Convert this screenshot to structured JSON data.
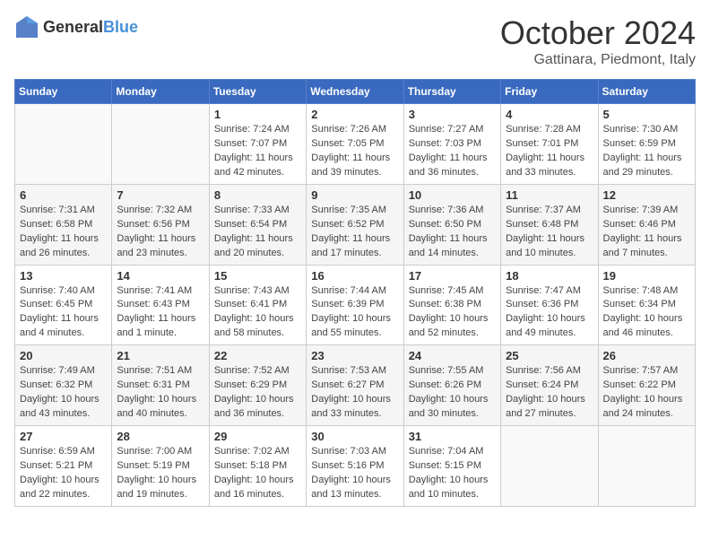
{
  "logo": {
    "general": "General",
    "blue": "Blue"
  },
  "header": {
    "month": "October 2024",
    "location": "Gattinara, Piedmont, Italy"
  },
  "weekdays": [
    "Sunday",
    "Monday",
    "Tuesday",
    "Wednesday",
    "Thursday",
    "Friday",
    "Saturday"
  ],
  "weeks": [
    [
      {
        "day": "",
        "sunrise": "",
        "sunset": "",
        "daylight": ""
      },
      {
        "day": "",
        "sunrise": "",
        "sunset": "",
        "daylight": ""
      },
      {
        "day": "1",
        "sunrise": "Sunrise: 7:24 AM",
        "sunset": "Sunset: 7:07 PM",
        "daylight": "Daylight: 11 hours and 42 minutes."
      },
      {
        "day": "2",
        "sunrise": "Sunrise: 7:26 AM",
        "sunset": "Sunset: 7:05 PM",
        "daylight": "Daylight: 11 hours and 39 minutes."
      },
      {
        "day": "3",
        "sunrise": "Sunrise: 7:27 AM",
        "sunset": "Sunset: 7:03 PM",
        "daylight": "Daylight: 11 hours and 36 minutes."
      },
      {
        "day": "4",
        "sunrise": "Sunrise: 7:28 AM",
        "sunset": "Sunset: 7:01 PM",
        "daylight": "Daylight: 11 hours and 33 minutes."
      },
      {
        "day": "5",
        "sunrise": "Sunrise: 7:30 AM",
        "sunset": "Sunset: 6:59 PM",
        "daylight": "Daylight: 11 hours and 29 minutes."
      }
    ],
    [
      {
        "day": "6",
        "sunrise": "Sunrise: 7:31 AM",
        "sunset": "Sunset: 6:58 PM",
        "daylight": "Daylight: 11 hours and 26 minutes."
      },
      {
        "day": "7",
        "sunrise": "Sunrise: 7:32 AM",
        "sunset": "Sunset: 6:56 PM",
        "daylight": "Daylight: 11 hours and 23 minutes."
      },
      {
        "day": "8",
        "sunrise": "Sunrise: 7:33 AM",
        "sunset": "Sunset: 6:54 PM",
        "daylight": "Daylight: 11 hours and 20 minutes."
      },
      {
        "day": "9",
        "sunrise": "Sunrise: 7:35 AM",
        "sunset": "Sunset: 6:52 PM",
        "daylight": "Daylight: 11 hours and 17 minutes."
      },
      {
        "day": "10",
        "sunrise": "Sunrise: 7:36 AM",
        "sunset": "Sunset: 6:50 PM",
        "daylight": "Daylight: 11 hours and 14 minutes."
      },
      {
        "day": "11",
        "sunrise": "Sunrise: 7:37 AM",
        "sunset": "Sunset: 6:48 PM",
        "daylight": "Daylight: 11 hours and 10 minutes."
      },
      {
        "day": "12",
        "sunrise": "Sunrise: 7:39 AM",
        "sunset": "Sunset: 6:46 PM",
        "daylight": "Daylight: 11 hours and 7 minutes."
      }
    ],
    [
      {
        "day": "13",
        "sunrise": "Sunrise: 7:40 AM",
        "sunset": "Sunset: 6:45 PM",
        "daylight": "Daylight: 11 hours and 4 minutes."
      },
      {
        "day": "14",
        "sunrise": "Sunrise: 7:41 AM",
        "sunset": "Sunset: 6:43 PM",
        "daylight": "Daylight: 11 hours and 1 minute."
      },
      {
        "day": "15",
        "sunrise": "Sunrise: 7:43 AM",
        "sunset": "Sunset: 6:41 PM",
        "daylight": "Daylight: 10 hours and 58 minutes."
      },
      {
        "day": "16",
        "sunrise": "Sunrise: 7:44 AM",
        "sunset": "Sunset: 6:39 PM",
        "daylight": "Daylight: 10 hours and 55 minutes."
      },
      {
        "day": "17",
        "sunrise": "Sunrise: 7:45 AM",
        "sunset": "Sunset: 6:38 PM",
        "daylight": "Daylight: 10 hours and 52 minutes."
      },
      {
        "day": "18",
        "sunrise": "Sunrise: 7:47 AM",
        "sunset": "Sunset: 6:36 PM",
        "daylight": "Daylight: 10 hours and 49 minutes."
      },
      {
        "day": "19",
        "sunrise": "Sunrise: 7:48 AM",
        "sunset": "Sunset: 6:34 PM",
        "daylight": "Daylight: 10 hours and 46 minutes."
      }
    ],
    [
      {
        "day": "20",
        "sunrise": "Sunrise: 7:49 AM",
        "sunset": "Sunset: 6:32 PM",
        "daylight": "Daylight: 10 hours and 43 minutes."
      },
      {
        "day": "21",
        "sunrise": "Sunrise: 7:51 AM",
        "sunset": "Sunset: 6:31 PM",
        "daylight": "Daylight: 10 hours and 40 minutes."
      },
      {
        "day": "22",
        "sunrise": "Sunrise: 7:52 AM",
        "sunset": "Sunset: 6:29 PM",
        "daylight": "Daylight: 10 hours and 36 minutes."
      },
      {
        "day": "23",
        "sunrise": "Sunrise: 7:53 AM",
        "sunset": "Sunset: 6:27 PM",
        "daylight": "Daylight: 10 hours and 33 minutes."
      },
      {
        "day": "24",
        "sunrise": "Sunrise: 7:55 AM",
        "sunset": "Sunset: 6:26 PM",
        "daylight": "Daylight: 10 hours and 30 minutes."
      },
      {
        "day": "25",
        "sunrise": "Sunrise: 7:56 AM",
        "sunset": "Sunset: 6:24 PM",
        "daylight": "Daylight: 10 hours and 27 minutes."
      },
      {
        "day": "26",
        "sunrise": "Sunrise: 7:57 AM",
        "sunset": "Sunset: 6:22 PM",
        "daylight": "Daylight: 10 hours and 24 minutes."
      }
    ],
    [
      {
        "day": "27",
        "sunrise": "Sunrise: 6:59 AM",
        "sunset": "Sunset: 5:21 PM",
        "daylight": "Daylight: 10 hours and 22 minutes."
      },
      {
        "day": "28",
        "sunrise": "Sunrise: 7:00 AM",
        "sunset": "Sunset: 5:19 PM",
        "daylight": "Daylight: 10 hours and 19 minutes."
      },
      {
        "day": "29",
        "sunrise": "Sunrise: 7:02 AM",
        "sunset": "Sunset: 5:18 PM",
        "daylight": "Daylight: 10 hours and 16 minutes."
      },
      {
        "day": "30",
        "sunrise": "Sunrise: 7:03 AM",
        "sunset": "Sunset: 5:16 PM",
        "daylight": "Daylight: 10 hours and 13 minutes."
      },
      {
        "day": "31",
        "sunrise": "Sunrise: 7:04 AM",
        "sunset": "Sunset: 5:15 PM",
        "daylight": "Daylight: 10 hours and 10 minutes."
      },
      {
        "day": "",
        "sunrise": "",
        "sunset": "",
        "daylight": ""
      },
      {
        "day": "",
        "sunrise": "",
        "sunset": "",
        "daylight": ""
      }
    ]
  ]
}
